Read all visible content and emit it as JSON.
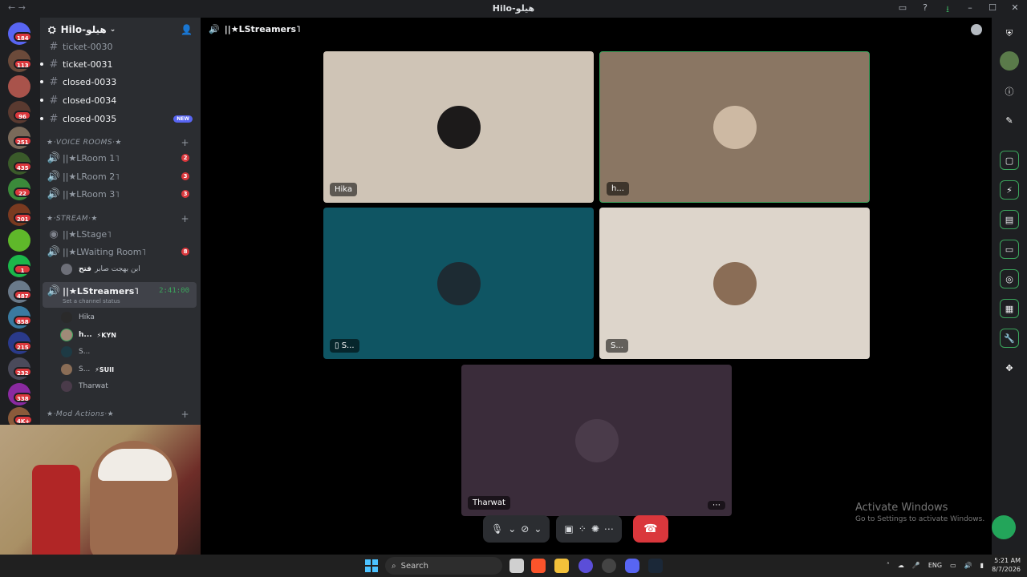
{
  "window": {
    "title": "Hilo-هيلو"
  },
  "server": {
    "name": "Hilo-هيلو"
  },
  "guild_badges": [
    "184",
    "113",
    "96",
    "251",
    "435",
    "22",
    "201",
    "1",
    "487",
    "858",
    "215",
    "232",
    "338",
    "4K+"
  ],
  "text_channels": [
    {
      "name": "ticket-0030"
    },
    {
      "name": "ticket-0031"
    },
    {
      "name": "closed-0033"
    },
    {
      "name": "closed-0034"
    },
    {
      "name": "closed-0035",
      "badge": "NEW"
    }
  ],
  "voice_category": "★·VOICE ROOMS·★",
  "voice_rooms": [
    {
      "name": "||★LRoom 1˥",
      "count": "2"
    },
    {
      "name": "||★LRoom 2˥",
      "count": "3"
    },
    {
      "name": "||★LRoom 3˥",
      "count": "3"
    }
  ],
  "stream_category": "★·STREAM·★",
  "stream_channels": [
    {
      "name": "||★LStage˥"
    },
    {
      "name": "||★LWaiting Room˥",
      "count": "8"
    }
  ],
  "waiting_user": {
    "name": "ابن بهجت صابر",
    "tag": "فتح"
  },
  "active_channel": {
    "name": "||★LStreamers˥",
    "timer": "2:41:00",
    "status": "Set a channel status"
  },
  "members": [
    {
      "name": "Hika",
      "tag": ""
    },
    {
      "name": "h...",
      "tag": "⚡KYN"
    },
    {
      "name": "S...",
      "tag": ""
    },
    {
      "name": "S...",
      "tag": "⚡SUII"
    },
    {
      "name": "Tharwat",
      "tag": ""
    }
  ],
  "mod_category": "★·Mod Actions·★",
  "stage": {
    "channel_title": "||★LStreamers˥",
    "tiles": [
      {
        "name": "Hika",
        "bg": "#cfc4b6",
        "avatar": "#1c1a1a"
      },
      {
        "name": "h...",
        "bg": "#8a7663",
        "avatar": "#cdb9a3"
      },
      {
        "name": "S...",
        "bg": "#0f5563",
        "avatar": "#1d2b33"
      },
      {
        "name": "S...",
        "bg": "#ddd5cb",
        "avatar": "#8a6d56"
      },
      {
        "name": "Tharwat",
        "bg": "#3a2c3a",
        "avatar": "#4a3b4a"
      }
    ]
  },
  "watermark": {
    "line1": "Activate Windows",
    "line2": "Go to Settings to activate Windows."
  },
  "taskbar": {
    "search_label": "Search",
    "lang": "ENG",
    "time": "5:21 AM",
    "date": "8/7/2026"
  },
  "colors": {
    "accent": "#5865f2",
    "danger": "#da373c",
    "online": "#23a55a",
    "speaking": "#3ba55c"
  }
}
